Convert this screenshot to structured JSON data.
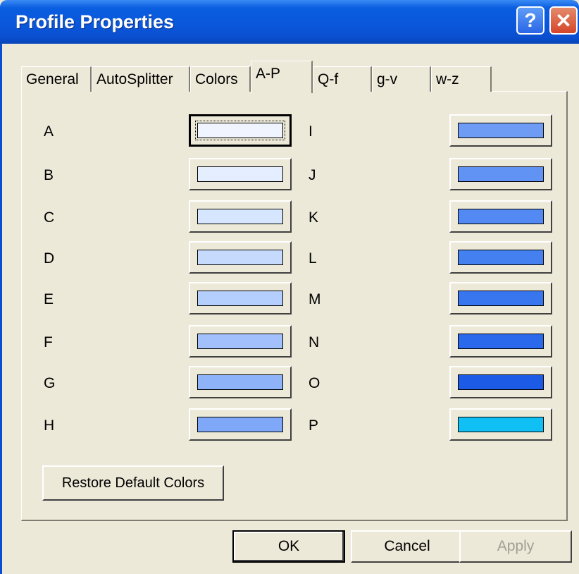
{
  "window": {
    "title": "Profile Properties"
  },
  "titlebar": {
    "help_glyph": "?",
    "close_glyph": "✕"
  },
  "tabs": [
    {
      "label": "General",
      "selected": false
    },
    {
      "label": "AutoSplitter",
      "selected": false
    },
    {
      "label": "Colors",
      "selected": false
    },
    {
      "label": "A-P",
      "selected": true
    },
    {
      "label": "Q-f",
      "selected": false
    },
    {
      "label": "g-v",
      "selected": false
    },
    {
      "label": "w-z",
      "selected": false
    }
  ],
  "left_colors": [
    {
      "label": "A",
      "color": "#f0f4ff"
    },
    {
      "label": "B",
      "color": "#e4eefe"
    },
    {
      "label": "C",
      "color": "#d6e6fe"
    },
    {
      "label": "D",
      "color": "#c6dafd"
    },
    {
      "label": "E",
      "color": "#b4cefd"
    },
    {
      "label": "F",
      "color": "#a2c0fb"
    },
    {
      "label": "G",
      "color": "#8fb3f9"
    },
    {
      "label": "H",
      "color": "#7fa8f8"
    }
  ],
  "right_colors": [
    {
      "label": "I",
      "color": "#6e9cf5"
    },
    {
      "label": "J",
      "color": "#6093f3"
    },
    {
      "label": "K",
      "color": "#5289f2"
    },
    {
      "label": "L",
      "color": "#4580f0"
    },
    {
      "label": "M",
      "color": "#3876ef"
    },
    {
      "label": "N",
      "color": "#2b69ec"
    },
    {
      "label": "O",
      "color": "#1c5be6"
    },
    {
      "label": "P",
      "color": "#10c0f4"
    }
  ],
  "restore_label": "Restore Default Colors",
  "buttons": {
    "ok": "OK",
    "cancel": "Cancel",
    "apply": "Apply"
  }
}
